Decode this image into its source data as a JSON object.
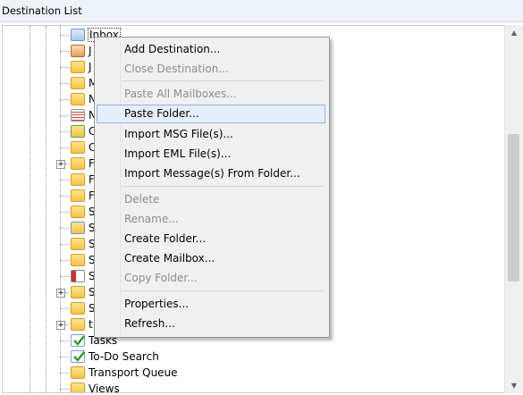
{
  "header": {
    "title": "Destination List"
  },
  "tree": {
    "selected_label": "Inbox",
    "visible_labels": [
      "Tasks",
      "To-Do Search",
      "Transport Queue",
      "Views"
    ],
    "partial_letters": [
      "J",
      "J",
      "M",
      "N",
      "N",
      "C",
      "C",
      "F",
      "F",
      "F",
      "S",
      "S",
      "S",
      "S",
      "S",
      "S",
      "S",
      "t"
    ]
  },
  "menu": {
    "items": [
      {
        "label": "Add Destination...",
        "enabled": true
      },
      {
        "label": "Close Destination...",
        "enabled": false
      },
      {
        "label": "Paste All Mailboxes...",
        "enabled": false
      },
      {
        "label": "Paste Folder...",
        "enabled": true,
        "highlighted": true
      },
      {
        "label": "Import MSG File(s)...",
        "enabled": true
      },
      {
        "label": "Import EML File(s)...",
        "enabled": true
      },
      {
        "label": "Import Message(s) From Folder...",
        "enabled": true
      },
      {
        "label": "Delete",
        "enabled": false
      },
      {
        "label": "Rename...",
        "enabled": false
      },
      {
        "label": "Create Folder...",
        "enabled": true
      },
      {
        "label": "Create Mailbox...",
        "enabled": true
      },
      {
        "label": "Copy Folder...",
        "enabled": false
      },
      {
        "label": "Properties...",
        "enabled": true
      },
      {
        "label": "Refresh...",
        "enabled": true
      }
    ]
  },
  "colors": {
    "highlight_bg": "#e5eefa",
    "highlight_border": "#8fb4e2",
    "disabled_text": "#8d8d8d"
  }
}
